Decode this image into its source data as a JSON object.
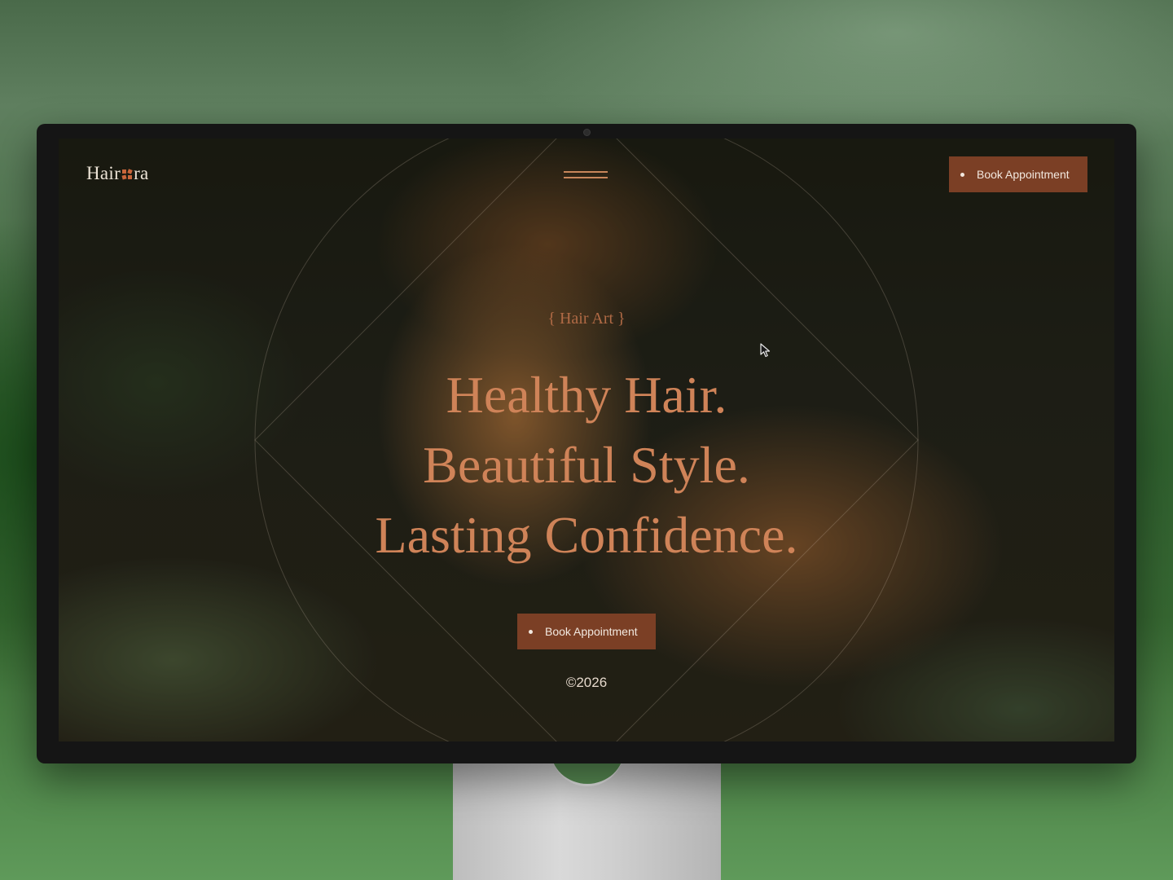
{
  "site": {
    "logo_prefix": "Hair",
    "logo_suffix": "ra",
    "logo_mark_color": "#c8653a"
  },
  "nav": {
    "menu_icon": "hamburger-menu-icon",
    "cta_label": "Book Appointment"
  },
  "hero": {
    "eyebrow": "{ Hair Art }",
    "headline_lines": [
      "Healthy Hair.",
      "Beautiful Style.",
      "Lasting Confidence."
    ],
    "cta_label": "Book Appointment",
    "copyright": "©2026"
  },
  "colors": {
    "accent_button": "#7b3f25",
    "headline_text": "#cf8358",
    "eyebrow_text": "#b06a45"
  }
}
